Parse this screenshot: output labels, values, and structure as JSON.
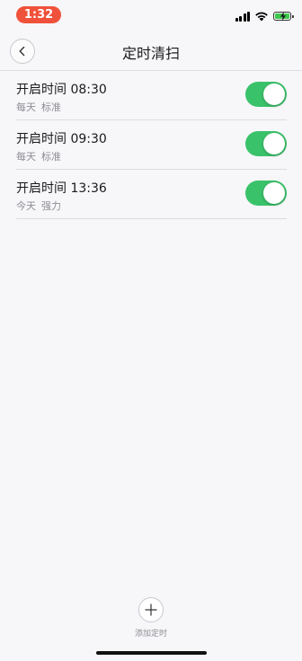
{
  "status_bar": {
    "time": "1:32",
    "time_pill_color": "#f0513a",
    "battery_color": "#3ec84e"
  },
  "nav": {
    "title": "定时清扫",
    "back_icon": "chevron-left-icon"
  },
  "schedules": [
    {
      "title": "开启时间 08:30",
      "day": "每天",
      "mode": "标准",
      "enabled": true
    },
    {
      "title": "开启时间 09:30",
      "day": "每天",
      "mode": "标准",
      "enabled": true
    },
    {
      "title": "开启时间 13:36",
      "day": "今天",
      "mode": "强力",
      "enabled": true
    }
  ],
  "add_timer": {
    "label": "添加定时",
    "icon": "plus-icon"
  },
  "colors": {
    "toggle_on": "#3ac26a",
    "background": "#f7f6f9"
  }
}
